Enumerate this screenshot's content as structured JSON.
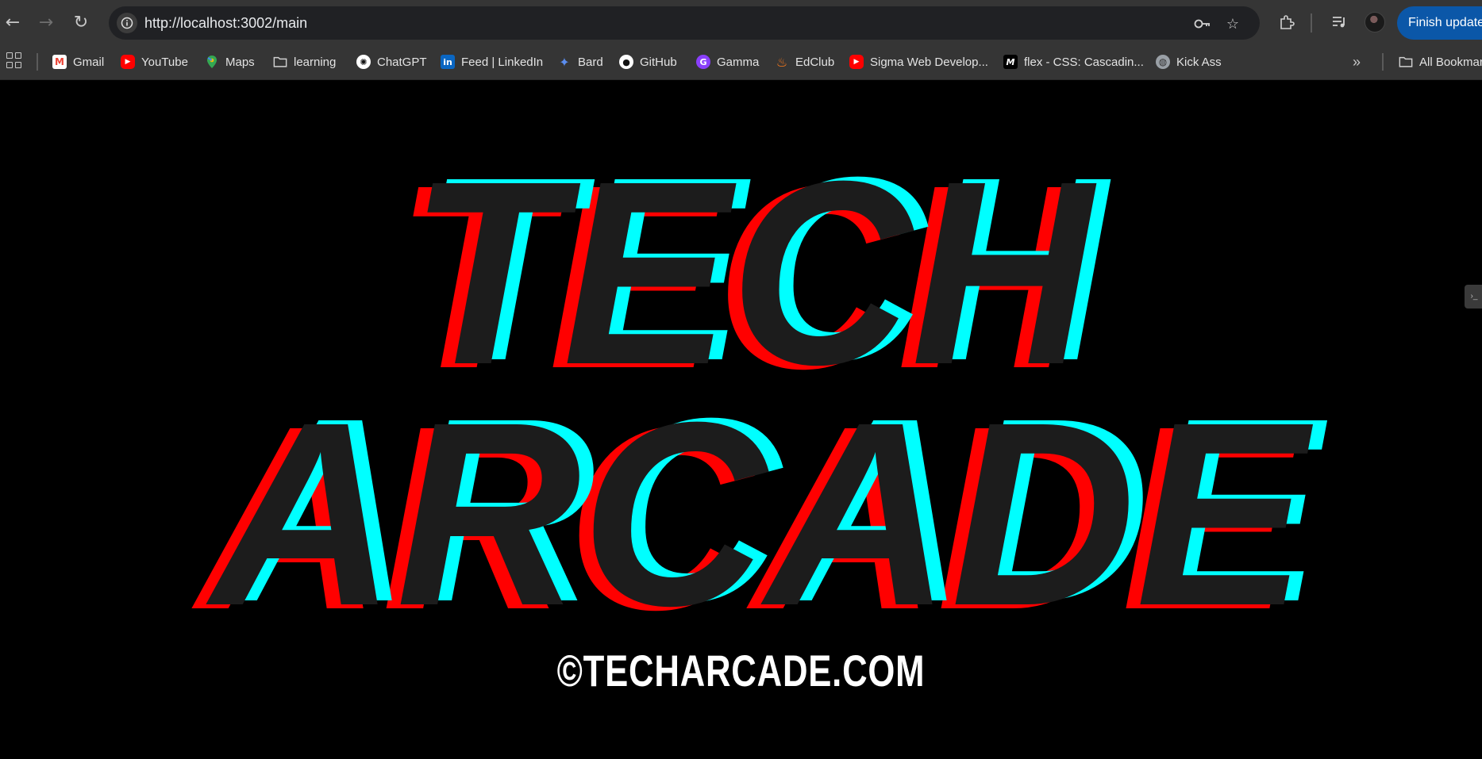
{
  "browser": {
    "url": "http://localhost:3002/main",
    "finish_update_label": "Finish update"
  },
  "bookmarks": [
    {
      "label": "Gmail",
      "icon": "gmail-icon"
    },
    {
      "label": "YouTube",
      "icon": "youtube-icon"
    },
    {
      "label": "Maps",
      "icon": "maps-icon"
    },
    {
      "label": "learning",
      "icon": "folder-icon"
    },
    {
      "label": "ChatGPT",
      "icon": "chatgpt-icon"
    },
    {
      "label": "Feed | LinkedIn",
      "icon": "linkedin-icon"
    },
    {
      "label": "Bard",
      "icon": "bard-icon"
    },
    {
      "label": "GitHub",
      "icon": "github-icon"
    },
    {
      "label": "Gamma",
      "icon": "gamma-icon"
    },
    {
      "label": "EdClub",
      "icon": "edclub-icon"
    },
    {
      "label": "Sigma Web Develop...",
      "icon": "youtube-icon"
    },
    {
      "label": "flex - CSS: Cascadin...",
      "icon": "mdn-icon"
    },
    {
      "label": "Kick Ass",
      "icon": "globe-icon"
    }
  ],
  "all_bookmarks_label": "All Bookmarks",
  "page": {
    "logo_line1": "TECH",
    "logo_line2": "ARCADE",
    "copyright": "©TECHARCADE.COM"
  },
  "colors": {
    "logo_fill": "#1c1c1c",
    "logo_red": "#ff0000",
    "logo_cyan": "#00ffff",
    "background": "#000000",
    "accent_button": "#0b57a8"
  }
}
